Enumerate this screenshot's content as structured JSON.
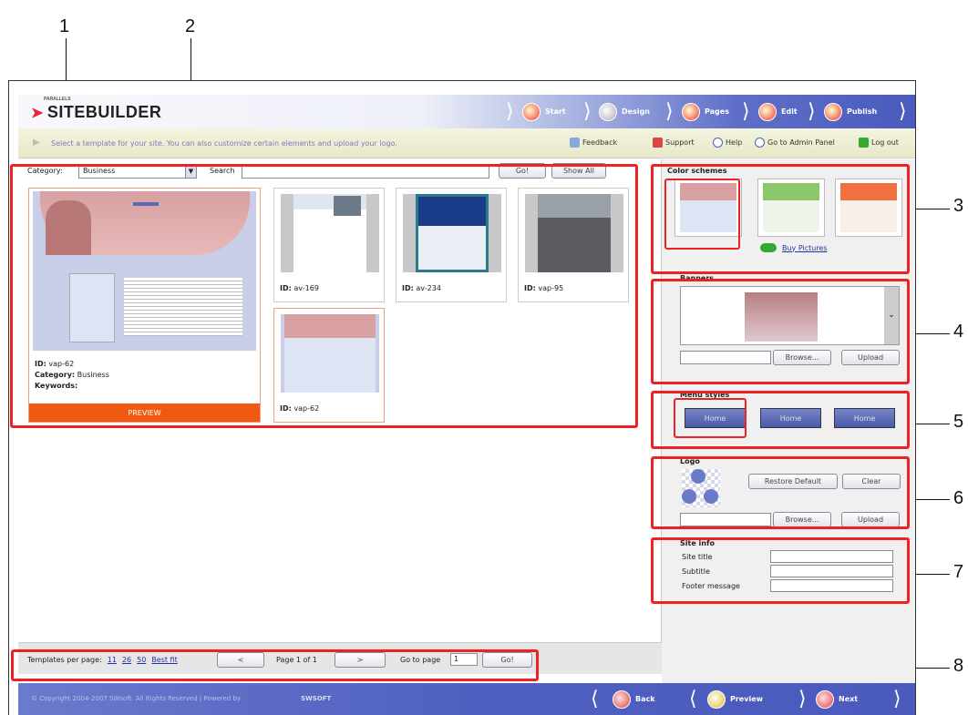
{
  "callouts": [
    "1",
    "2",
    "3",
    "4",
    "5",
    "6",
    "7",
    "8"
  ],
  "header": {
    "logo_small": "PARALLELS",
    "logo": "SITEBUILDER",
    "steps": [
      {
        "label": "Start"
      },
      {
        "label": "Design"
      },
      {
        "label": "Pages"
      },
      {
        "label": "Edit"
      },
      {
        "label": "Publish"
      }
    ]
  },
  "infobar": {
    "message": "Select a template for your site. You can also customize certain elements and upload your logo.",
    "links": [
      {
        "label": "Feedback"
      },
      {
        "label": "Support"
      },
      {
        "label": "Help"
      },
      {
        "label": "Go to Admin Panel"
      },
      {
        "label": "Log out"
      }
    ]
  },
  "filter": {
    "category_label": "Category:",
    "category_value": "Business",
    "search_label": "Search",
    "search_value": "",
    "go_label": "Go!",
    "show_all_label": "Show All"
  },
  "preview": {
    "id_label": "ID:",
    "id": "vap-62",
    "category_label": "Category:",
    "category": "Business",
    "keywords_label": "Keywords:",
    "keywords": "",
    "preview_button": "PREVIEW"
  },
  "templates": [
    {
      "id_label": "ID:",
      "id": "av-169"
    },
    {
      "id_label": "ID:",
      "id": "av-234"
    },
    {
      "id_label": "ID:",
      "id": "vap-95"
    },
    {
      "id_label": "ID:",
      "id": "vap-62"
    }
  ],
  "pagination": {
    "per_page_label": "Templates per page:",
    "per_page_options": [
      "11",
      "26",
      "50",
      "Best fit"
    ],
    "prev": "<",
    "page_text": "Page 1 of 1",
    "next": ">",
    "goto_label": "Go to page",
    "goto_value": "1",
    "goto_button": "Go!"
  },
  "color_schemes": {
    "title": "Color schemes",
    "buy_pictures": "Buy Pictures"
  },
  "banners": {
    "title": "Banners",
    "browse": "Browse...",
    "upload": "Upload"
  },
  "menu_styles": {
    "title": "Menu styles",
    "items": [
      "Home",
      "Home",
      "Home"
    ]
  },
  "logo": {
    "title": "Logo",
    "restore": "Restore Default",
    "clear": "Clear",
    "browse": "Browse...",
    "upload": "Upload"
  },
  "site_info": {
    "title": "Site info",
    "fields": [
      {
        "label": "Site title",
        "value": ""
      },
      {
        "label": "Subtitle",
        "value": ""
      },
      {
        "label": "Footer message",
        "value": ""
      }
    ]
  },
  "footer": {
    "copyright": "© Copyright 2004-2007 SWsoft. All Rights Reserved | Powered by",
    "brand": "SWSOFT",
    "back": "Back",
    "preview": "Preview",
    "next": "Next"
  },
  "colors": {
    "accent_red": "#e22222",
    "header_blue": "#4a5abd",
    "preview_orange": "#f05a10"
  }
}
